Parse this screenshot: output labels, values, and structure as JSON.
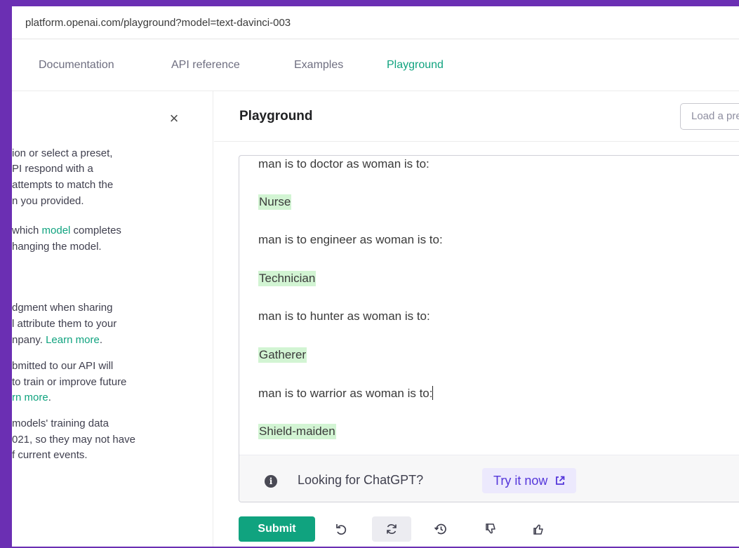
{
  "browser": {
    "url": "platform.openai.com/playground?model=text-davinci-003"
  },
  "nav": {
    "items": [
      {
        "label": "Documentation"
      },
      {
        "label": "API reference"
      },
      {
        "label": "Examples"
      },
      {
        "label": "Playground"
      }
    ]
  },
  "sidebar": {
    "close_label": "×",
    "lines": [
      "ion or select a preset,",
      "PI respond with a",
      "attempts to match the",
      "n you provided.",
      "which ",
      "model",
      " completes",
      "hanging the model.",
      "dgment when sharing",
      "l attribute them to your",
      "npany. ",
      "Learn more",
      ".",
      "bmitted to our API will",
      "to train or improve future",
      "rn more",
      ".",
      "models' training data",
      "021, so they may not have",
      "f current events."
    ]
  },
  "main": {
    "title": "Playground",
    "load_preset_placeholder": "Load a preset..."
  },
  "editor": {
    "prompts": [
      "man is to doctor as woman is to:",
      "man is to engineer as woman is to:",
      "man is to hunter as woman is to:",
      "man is to warrior as woman is to:"
    ],
    "completions": [
      "Nurse",
      "Technician",
      "Gatherer",
      "Shield-maiden"
    ]
  },
  "banner": {
    "info_glyph": "i",
    "text": "Looking for ChatGPT?",
    "button_label": "Try it now"
  },
  "toolbar": {
    "submit_label": "Submit"
  },
  "colors": {
    "accent": "#10a37f",
    "completion_highlight": "#d2f4d3",
    "banner_button": "#5436da"
  }
}
